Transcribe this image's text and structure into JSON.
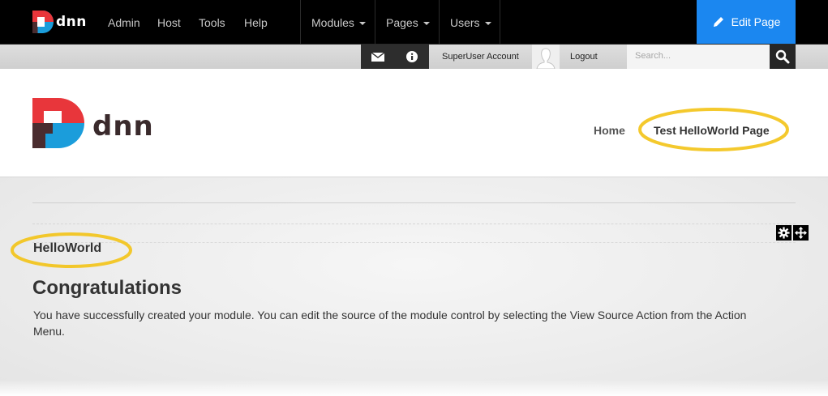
{
  "colors": {
    "topbar_bg": "#000000",
    "edit_button_bg": "#1b87f0",
    "logo_red": "#e8363b",
    "logo_blue": "#1b9ddb",
    "logo_dark": "#4a2c2f",
    "highlight": "#f3c316"
  },
  "topbar": {
    "logo_text": "dnn",
    "links": [
      {
        "label": "Admin"
      },
      {
        "label": "Host"
      },
      {
        "label": "Tools"
      },
      {
        "label": "Help"
      }
    ],
    "menus": [
      {
        "label": "Modules"
      },
      {
        "label": "Pages"
      },
      {
        "label": "Users"
      }
    ],
    "edit_button": {
      "label": "Edit Page",
      "icon": "pencil-icon"
    }
  },
  "userbar": {
    "icons": [
      "mail-icon",
      "info-icon"
    ],
    "account_label": "SuperUser Account",
    "avatar_icon": "user-silhouette-icon",
    "logout_label": "Logout",
    "search_placeholder": "Search...",
    "search_icon": "search-icon"
  },
  "header": {
    "logo_text": "dnn",
    "nav": [
      {
        "label": "Home"
      },
      {
        "label": "Test HelloWorld Page"
      }
    ]
  },
  "content": {
    "module_title": "HelloWorld",
    "heading": "Congratulations",
    "body": "You have successfully created your module. You can edit the source of the module control by selecting the View Source Action from the Action Menu.",
    "action_icons": [
      "gear-icon",
      "move-icon"
    ]
  }
}
